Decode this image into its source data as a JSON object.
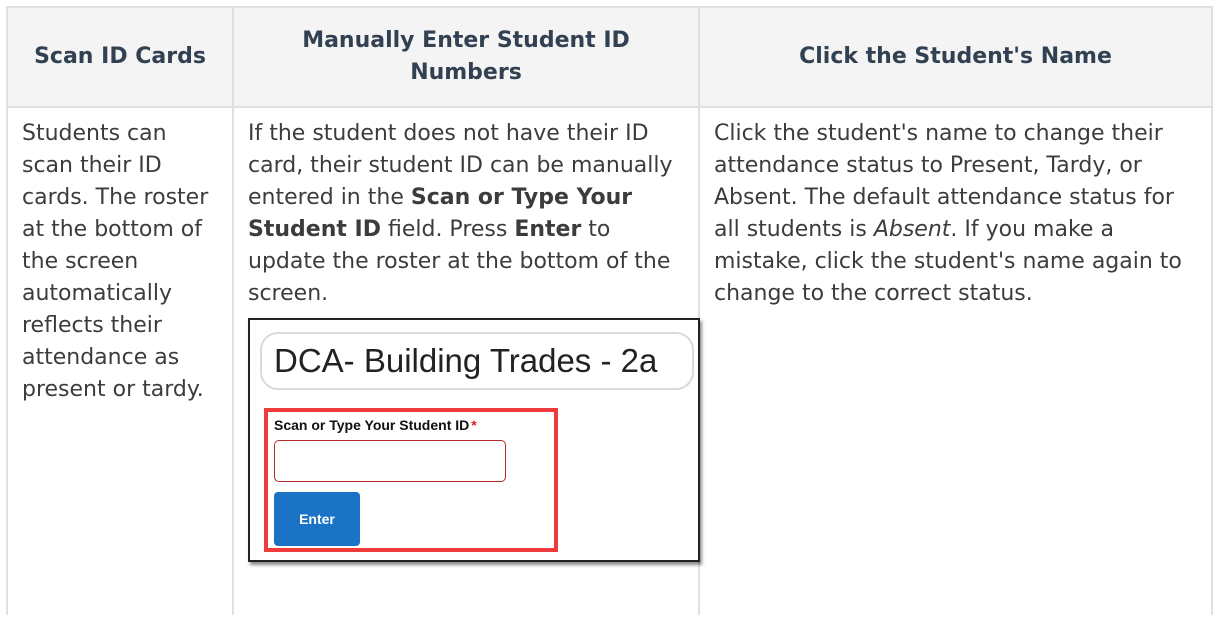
{
  "table": {
    "headers": [
      "Scan ID Cards",
      "Manually Enter Student ID Numbers",
      "Click the Student's Name"
    ],
    "col1": {
      "text": "Students can scan their ID cards. The roster at the bottom of the screen automatically reflects their attendance as present or tardy."
    },
    "col2": {
      "text_1": "If the student does not have their ID card, their student ID can be manually entered in the ",
      "bold_1": "Scan or Type Your Student ID",
      "text_2": " field. Press ",
      "bold_2": "Enter",
      "text_3": " to update the roster at the bottom of the screen."
    },
    "col3": {
      "text_1": "Click the student's name to change their attendance status to Present, Tardy, or Absent. The default attendance status for all students is ",
      "italic_1": "Absent",
      "text_2": ". If you make a mistake, click the student's name again to change to the correct status."
    }
  },
  "screenshot": {
    "course_name": "DCA- Building Trades - 2a",
    "field_label": "Scan or Type Your Student ID",
    "required_marker": "*",
    "input_value": "",
    "enter_label": "Enter",
    "highlight_color": "#ef3b3b",
    "button_color": "#1a73c4"
  }
}
